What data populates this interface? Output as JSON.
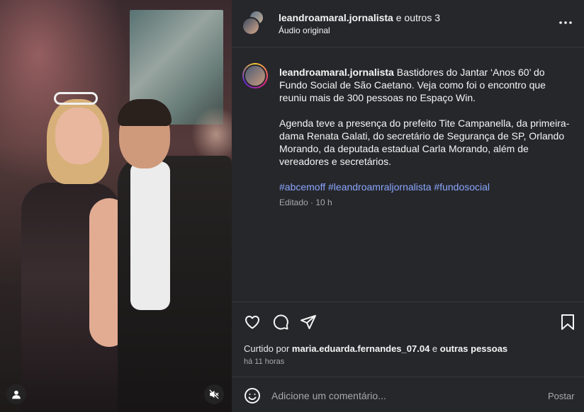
{
  "header": {
    "username": "leandroamaral.jornalista",
    "collab_suffix": " e outros 3",
    "audio": "Áudio original"
  },
  "caption": {
    "username": "leandroamaral.jornalista",
    "paragraph1": " Bastidores do Jantar ‘Anos 60’ do Fundo Social de São Caetano. Veja como foi o encontro que reuniu mais de 300 pessoas no Espaço Win.",
    "paragraph2": "Agenda teve a presença do prefeito Tite Campanella, da primeira-dama Renata Galati, do secretário de Segurança de SP, Orlando Morando, da deputada estadual Carla Morando, além de vereadores e secretários.",
    "hashtags": "#abcemoff #leandroamraljornalista #fundosocial",
    "meta": "Editado · 10 h"
  },
  "likes": {
    "prefix": "Curtido por ",
    "user": "maria.eduarda.fernandes_07.04",
    "middle": " e ",
    "others": "outras pessoas"
  },
  "time": "há 11 horas",
  "comment": {
    "placeholder": "Adicione um comentário...",
    "post_label": "Postar"
  },
  "icons": {
    "more": "more-icon",
    "like": "heart-icon",
    "comment": "comment-icon",
    "share": "share-icon",
    "save": "bookmark-icon",
    "emoji": "emoji-icon",
    "tagged": "user-icon",
    "mute": "mute-icon"
  },
  "colors": {
    "background": "#26272b",
    "hashtag": "#8aa6ff",
    "muted_text": "#a8a8a8"
  }
}
